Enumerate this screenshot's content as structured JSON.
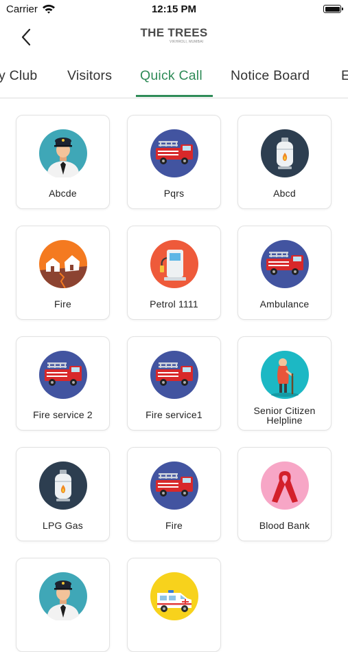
{
  "status_bar": {
    "carrier": "Carrier",
    "time": "12:15 PM"
  },
  "header": {
    "title": "THE TREES",
    "subtitle": "VIKHROLI, MUMBAI"
  },
  "tabs": [
    {
      "label": "y Club",
      "active": false
    },
    {
      "label": "Visitors",
      "active": false
    },
    {
      "label": "Quick Call",
      "active": true
    },
    {
      "label": "Notice Board",
      "active": false
    },
    {
      "label": "E",
      "active": false
    }
  ],
  "contacts": [
    {
      "label": "Abcde",
      "icon": "security-guard-icon"
    },
    {
      "label": "Pqrs",
      "icon": "fire-truck-icon"
    },
    {
      "label": "Abcd",
      "icon": "gas-cylinder-icon"
    },
    {
      "label": "Fire",
      "icon": "earthquake-house-icon"
    },
    {
      "label": "Petrol 1111",
      "icon": "fuel-pump-icon"
    },
    {
      "label": "Ambulance",
      "icon": "fire-truck-icon"
    },
    {
      "label": "Fire service 2",
      "icon": "fire-truck-icon"
    },
    {
      "label": "Fire service1",
      "icon": "fire-truck-icon"
    },
    {
      "label": "Senior Citizen Helpline",
      "icon": "senior-citizen-icon"
    },
    {
      "label": "LPG Gas",
      "icon": "gas-cylinder-icon"
    },
    {
      "label": "Fire",
      "icon": "fire-truck-icon"
    },
    {
      "label": "Blood Bank",
      "icon": "blood-ribbon-icon"
    },
    {
      "label": "",
      "icon": "security-guard-icon"
    },
    {
      "label": "",
      "icon": "ambulance-van-icon"
    }
  ],
  "colors": {
    "accent": "#2e8b57",
    "card_border": "#e2e2e2"
  }
}
